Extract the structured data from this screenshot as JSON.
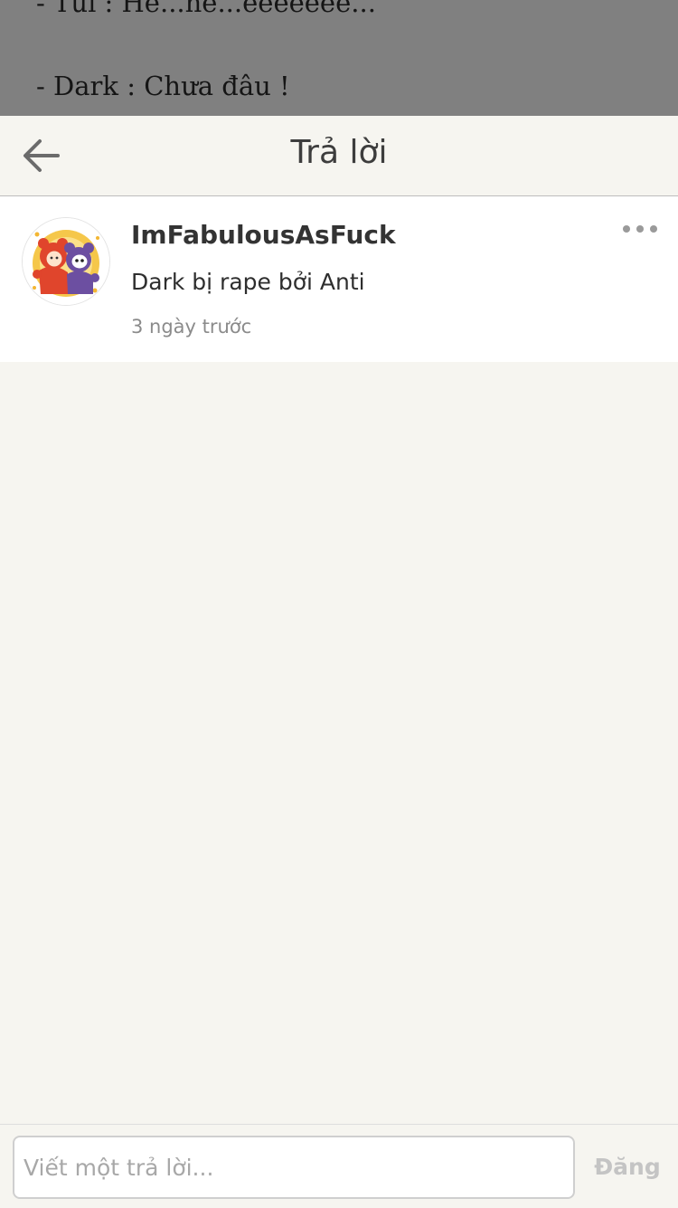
{
  "background_story": {
    "lines": [
      "- Tui : He...he...eeeeeee...",
      "- Dark : Chưa đâu !"
    ]
  },
  "header": {
    "title": "Trả lời",
    "back_icon": "arrow-left-icon"
  },
  "comment": {
    "author": "ImFabulousAsFuck",
    "text": "Dark bị rape bởi Anti",
    "timestamp": "3 ngày trước",
    "more_icon": "more-dots-icon",
    "avatar_icon": "user-avatar-illustration"
  },
  "composer": {
    "placeholder": "Viết một trả lời...",
    "value": "",
    "post_label": "Đăng"
  },
  "colors": {
    "overlay": "#808080",
    "background": "#f6f5f0",
    "card": "#ffffff",
    "title_text": "#3d3d3d",
    "muted_text": "#8b8b8b",
    "disabled_button": "#c4c4c4"
  }
}
